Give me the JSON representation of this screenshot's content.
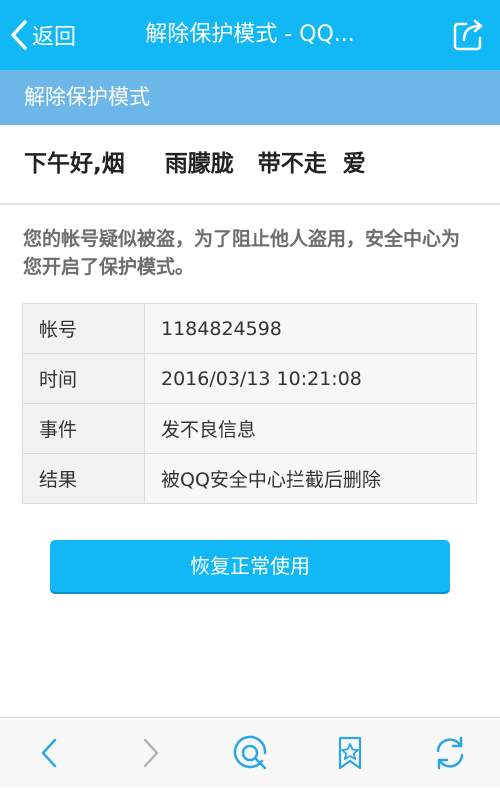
{
  "topbar": {
    "back_label": "返回",
    "title": "解除保护模式 - QQ...",
    "back_icon": "chevron-left-icon",
    "share_icon": "share-icon"
  },
  "section_header": "解除保护模式",
  "greeting": "下午好,烟     雨朦胧   带不走  爱",
  "notice": "您的帐号疑似被盗，为了阻止他人盗用，安全中心为您开启了保护模式。",
  "info_table": [
    {
      "label": "帐号",
      "value": "1184824598"
    },
    {
      "label": "时间",
      "value": "2016/03/13  10:21:08"
    },
    {
      "label": "事件",
      "value": "发不良信息"
    },
    {
      "label": "结果",
      "value": "被QQ安全中心拦截后删除"
    }
  ],
  "restore_button": "恢复正常使用",
  "bottom_bar": {
    "icons": [
      "back-arrow-icon",
      "forward-arrow-icon",
      "qq-browser-icon",
      "bookmark-star-icon",
      "refresh-icon"
    ]
  },
  "colors": {
    "topbar": "#12b7f5",
    "section_header": "#6cb6e8",
    "button": "#12b7f5",
    "toolbar_icon": "#2aa6e6"
  }
}
